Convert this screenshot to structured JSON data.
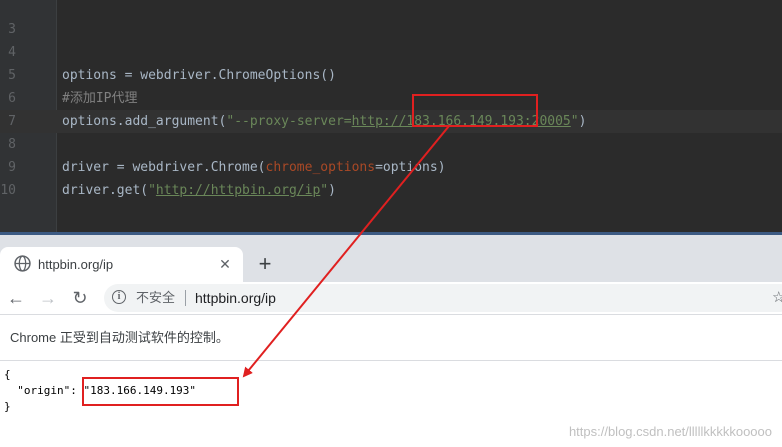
{
  "editor": {
    "lines": [
      {
        "num": "3",
        "tokens": []
      },
      {
        "num": "4",
        "tokens": []
      },
      {
        "num": "5",
        "tokens": [
          {
            "t": "options = webdriver.ChromeOptions()",
            "c": "default"
          }
        ]
      },
      {
        "num": "6",
        "tokens": [
          {
            "t": "#添加IP代理",
            "c": "comment"
          }
        ]
      },
      {
        "num": "7",
        "current": true,
        "tokens": [
          {
            "t": "options.add_argument(",
            "c": "default"
          },
          {
            "t": "\"--proxy-server=",
            "c": "string"
          },
          {
            "t": "http://183.166.149.193:20005",
            "c": "url"
          },
          {
            "t": "\"",
            "c": "string"
          },
          {
            "t": ")",
            "c": "paren"
          }
        ]
      },
      {
        "num": "8",
        "tokens": []
      },
      {
        "num": "9",
        "tokens": [
          {
            "t": "driver = webdriver.Chrome(",
            "c": "default"
          },
          {
            "t": "chrome_options",
            "c": "kwarg"
          },
          {
            "t": "=options)",
            "c": "default"
          }
        ]
      },
      {
        "num": "10",
        "tokens": [
          {
            "t": "driver.get(",
            "c": "default"
          },
          {
            "t": "\"",
            "c": "string"
          },
          {
            "t": "http://httpbin.org/ip",
            "c": "url"
          },
          {
            "t": "\"",
            "c": "string"
          },
          {
            "t": ")",
            "c": "default"
          }
        ]
      }
    ]
  },
  "browser": {
    "tab_title": "httpbin.org/ip",
    "tab_close": "✕",
    "new_tab": "+",
    "icons": {
      "back": "←",
      "forward": "→",
      "reload": "↻",
      "info": "i",
      "star": "☆"
    },
    "security_label": "不安全",
    "address": "httpbin.org/ip",
    "infobar_text": "Chrome 正受到自动测试软件的控制。",
    "json_lines": [
      "{",
      "  \"origin\": \"183.166.149.193\"",
      "}"
    ]
  },
  "watermark": "https://blog.csdn.net/lllllkkkkkooooo",
  "colors": {
    "editor_bg": "#2b2b2b",
    "annotation_red": "#e02020"
  }
}
